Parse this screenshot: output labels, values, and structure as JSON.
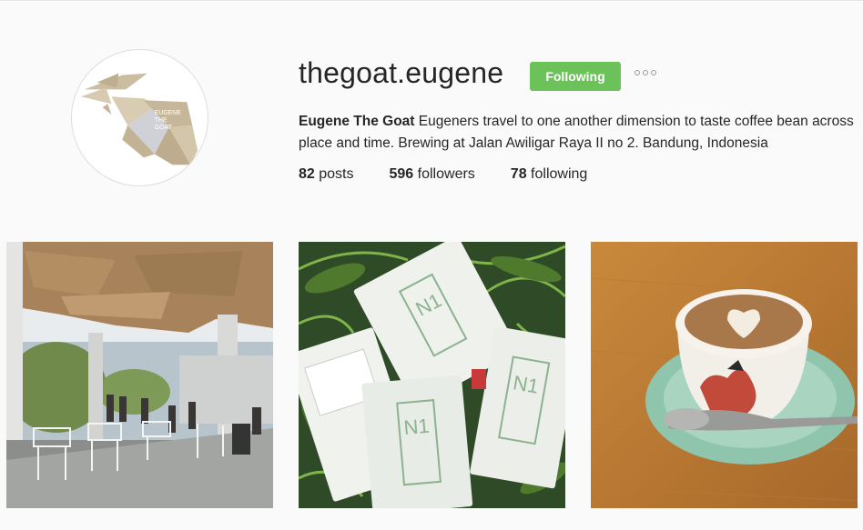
{
  "profile": {
    "username": "thegoat.eugene",
    "follow_label": "Following",
    "full_name": "Eugene The Goat",
    "bio": "Eugeners travel to one another dimension to taste coffee bean across place and time. Brewing at Jalan Awiligar Raya II no 2. Bandung, Indonesia",
    "logo_text": [
      "EUGENE",
      "THE",
      "GOAT"
    ]
  },
  "stats": {
    "posts_count": "82",
    "posts_label": "posts",
    "followers_count": "596",
    "followers_label": "followers",
    "following_count": "78",
    "following_label": "following"
  },
  "colors": {
    "follow_green": "#6bc259",
    "logo_tan": "#c7b79a"
  },
  "posts": [
    {
      "subject": "cafe-terrace-photo"
    },
    {
      "subject": "coffee-bags-photo"
    },
    {
      "subject": "latte-art-photo"
    }
  ]
}
